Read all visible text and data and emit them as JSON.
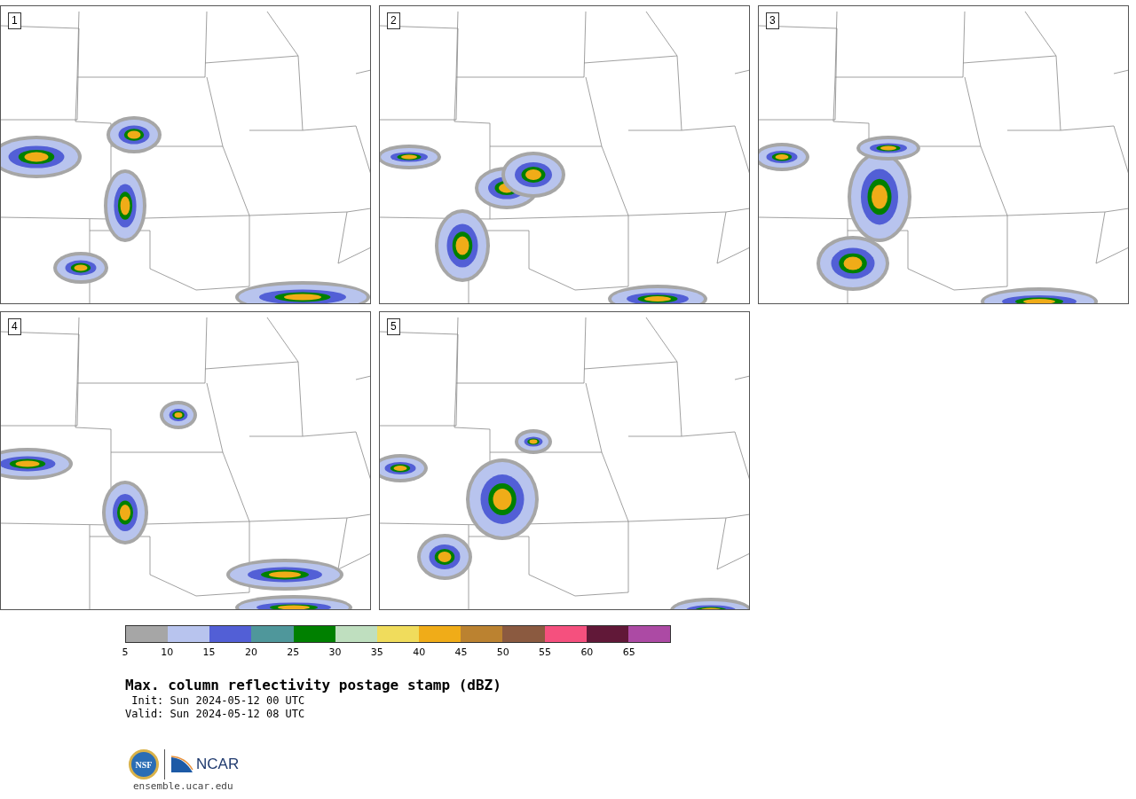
{
  "panels": [
    {
      "label": "1"
    },
    {
      "label": "2"
    },
    {
      "label": "3"
    },
    {
      "label": "4"
    },
    {
      "label": "5"
    }
  ],
  "colorbar": {
    "bins": [
      {
        "color": "#a6a6a6"
      },
      {
        "color": "#b8c4ee"
      },
      {
        "color": "#525fd6"
      },
      {
        "color": "#4f979b"
      },
      {
        "color": "#008000"
      },
      {
        "color": "#bfdfbf"
      },
      {
        "color": "#f0dc5c"
      },
      {
        "color": "#f0ac18"
      },
      {
        "color": "#bb8230"
      },
      {
        "color": "#8b5a40"
      },
      {
        "color": "#f5507e"
      },
      {
        "color": "#611838"
      },
      {
        "color": "#ac4aa4"
      }
    ],
    "ticks": [
      "5",
      "10",
      "15",
      "20",
      "25",
      "30",
      "35",
      "40",
      "45",
      "50",
      "55",
      "60",
      "65"
    ]
  },
  "title": "Max. column reflectivity postage stamp (dBZ)",
  "init": " Init: Sun 2024-05-12 00 UTC",
  "valid": "Valid: Sun 2024-05-12 08 UTC",
  "logo": {
    "nsf": "NSF",
    "ncar": "NCAR"
  },
  "url": "ensemble.ucar.edu"
}
